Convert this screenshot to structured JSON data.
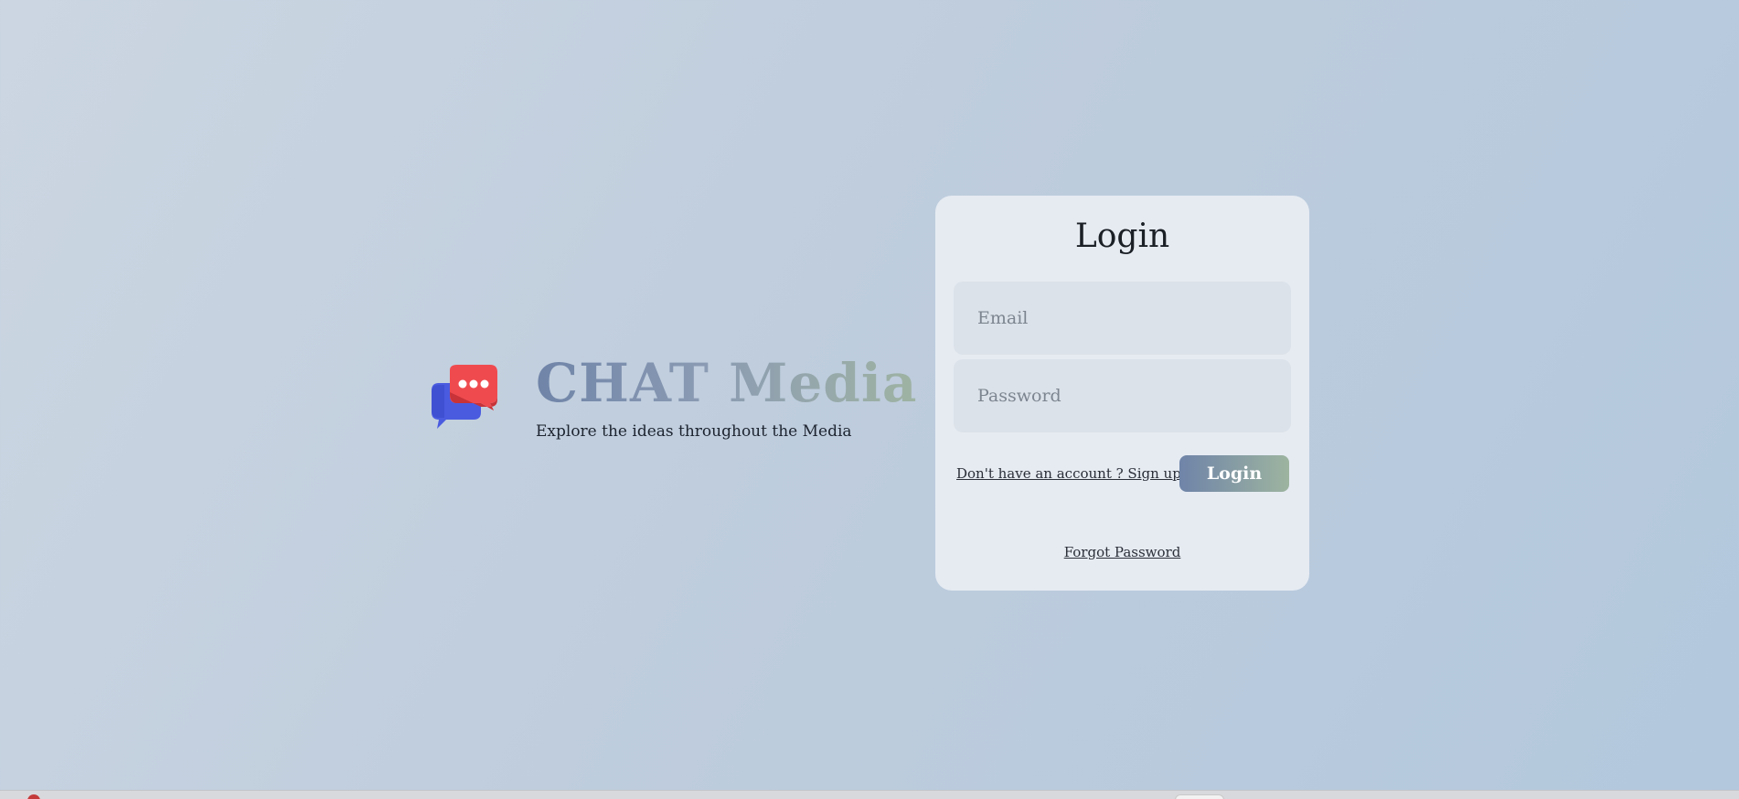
{
  "brand": {
    "logo_icon": "chat-bubbles-icon",
    "title_part1": "CHAT",
    "title_part2": "Media",
    "subtitle": "Explore the ideas throughout the Media"
  },
  "login_card": {
    "title": "Login",
    "email_placeholder": "Email",
    "password_placeholder": "Password",
    "signup_link": "Don't have an account ? Sign up",
    "login_button": "Login",
    "forgot_link": "Forgot Password"
  },
  "colors": {
    "gradient_start": "#6f84a8",
    "gradient_end": "#9fb3a3",
    "card_bg": "#e6ebf2",
    "field_bg": "#dce2e9"
  }
}
